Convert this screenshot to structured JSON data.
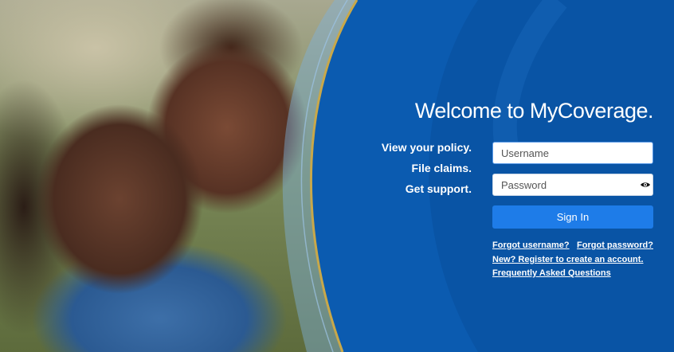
{
  "colors": {
    "panel": "#0b5bb0",
    "panel_dark": "#0a4f9c",
    "gold_stripe": "#c8a84a",
    "button": "#1e7ce8",
    "text": "#ffffff"
  },
  "welcome": "Welcome to MyCoverage.",
  "taglines": [
    "View your policy.",
    "File claims.",
    "Get support."
  ],
  "login": {
    "username_placeholder": "Username",
    "password_placeholder": "Password",
    "password_toggle_icon": "eye-icon",
    "sign_in_label": "Sign In"
  },
  "links": {
    "forgot_username": "Forgot username?",
    "forgot_password": "Forgot password?",
    "register": "New? Register to create an account.",
    "faq": "Frequently Asked Questions"
  }
}
